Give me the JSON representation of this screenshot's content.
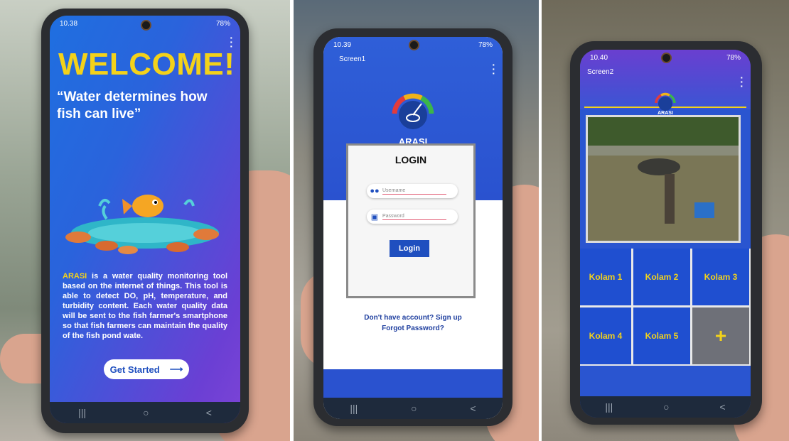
{
  "colors": {
    "accent_yellow": "#f3d21a",
    "primary_blue": "#1f4fbf",
    "purple": "#6b3fd4"
  },
  "phone1": {
    "status_time": "10.38",
    "status_icons": "78%",
    "welcome": "WELCOME!",
    "quote": "“Water determines how fish can live”",
    "desc_brand": "ARASI",
    "desc_rest": " is a water quality monitoring tool based on the internet of things. This tool is able to detect DO, pH, temperature, and turbidity content. Each water quality data will be sent to the fish farmer's smartphone so that fish farmers can maintain the quality of the fish pond wate.",
    "get_started": "Get Started",
    "arrow": "⟶",
    "nav_recent": "|||",
    "nav_home": "○",
    "nav_back": "<"
  },
  "phone2": {
    "status_time": "10.39",
    "status_icons": "78%",
    "appbar_title": "Screen1",
    "brand": "ARASI",
    "login_title": "LOGIN",
    "username_placeholder": "Username",
    "password_placeholder": "Password",
    "login_button": "Login",
    "signup_text": "Don't have account? Sign up",
    "forgot_text": "Forgot Password?",
    "nav_recent": "|||",
    "nav_home": "○",
    "nav_back": "<"
  },
  "phone3": {
    "status_time": "10.40",
    "status_icons": "78%",
    "appbar_title": "Screen2",
    "brand": "ARASI",
    "ponds": [
      "Kolam 1",
      "Kolam 2",
      "Kolam 3",
      "Kolam 4",
      "Kolam 5"
    ],
    "add_label": "+",
    "nav_recent": "|||",
    "nav_home": "○",
    "nav_back": "<"
  },
  "icons": [
    "user-icon",
    "lock-icon",
    "fish-icon",
    "gauge-logo-icon",
    "more-vert-icon"
  ]
}
